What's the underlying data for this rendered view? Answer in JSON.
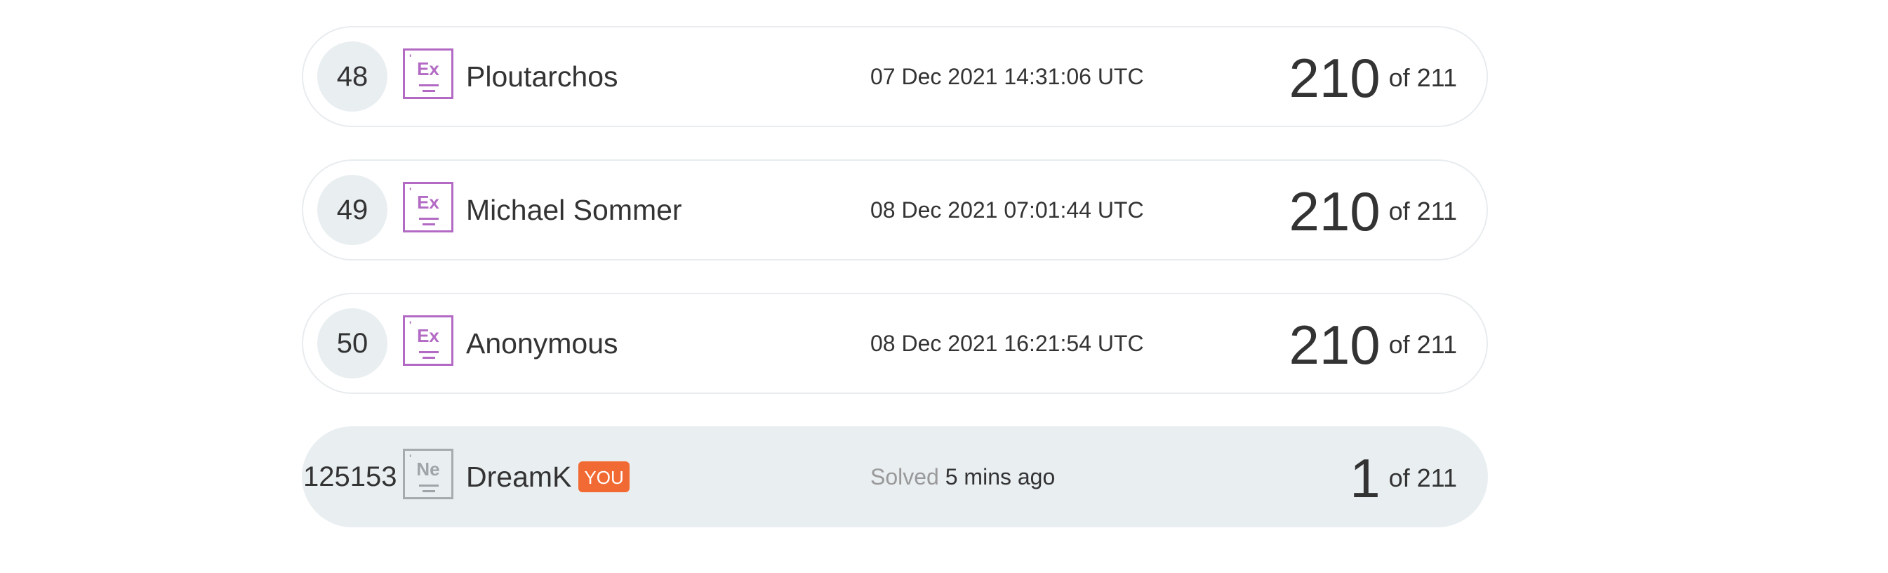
{
  "rows": [
    {
      "rank": "48",
      "element_symbol": "Ex",
      "name": "Ploutarchos",
      "timestamp": "07 Dec 2021 14:31:06 UTC",
      "score": "210",
      "of_text": "of 211"
    },
    {
      "rank": "49",
      "element_symbol": "Ex",
      "name": "Michael Sommer",
      "timestamp": "08 Dec 2021 07:01:44 UTC",
      "score": "210",
      "of_text": "of 211"
    },
    {
      "rank": "50",
      "element_symbol": "Ex",
      "name": "Anonymous",
      "timestamp": "08 Dec 2021 16:21:54 UTC",
      "score": "210",
      "of_text": "of 211"
    }
  ],
  "current_user": {
    "rank": "125153",
    "element_symbol": "Ne",
    "name": "DreamK",
    "you_badge": "YOU",
    "solved_label": "Solved",
    "solved_time": "5 mins ago",
    "score": "1",
    "of_text": "of 211"
  },
  "colors": {
    "element_purple": "#b36ac4",
    "element_grey": "#a6abae",
    "you_badge": "#f26a33",
    "highlight_row": "#e9eef1"
  },
  "icons": {
    "element_icon": "element-tile-icon"
  }
}
